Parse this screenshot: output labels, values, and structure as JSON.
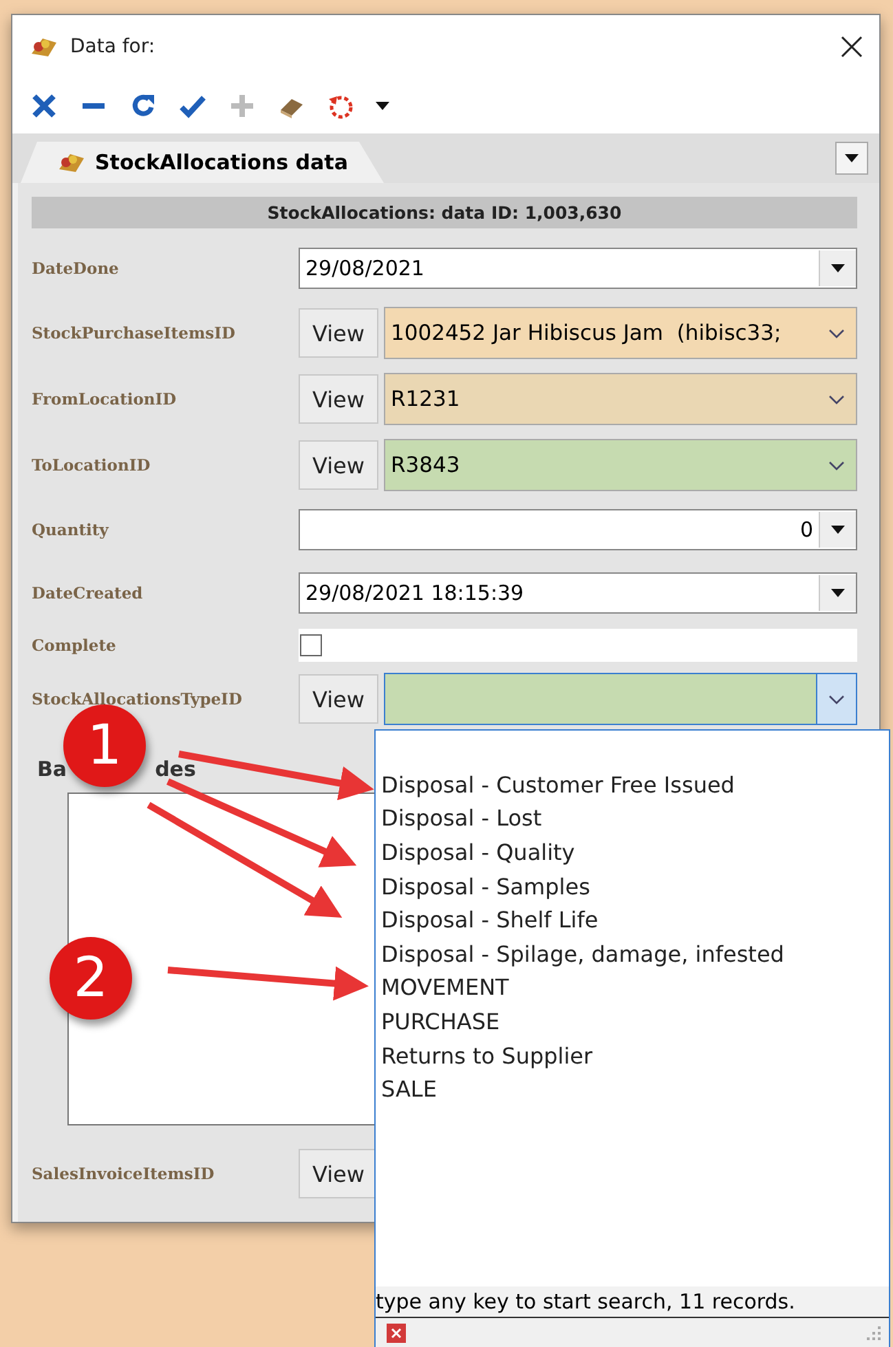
{
  "window": {
    "title": "Data for:"
  },
  "tabs": [
    {
      "label": "StockAllocations data",
      "selected": true
    }
  ],
  "header": "StockAllocations: data ID: 1,003,630",
  "fields": [
    {
      "kind": "date",
      "label": "DateDone",
      "value": "29/08/2021"
    },
    {
      "kind": "lookup",
      "label": "StockPurchaseItemsID",
      "button": "View",
      "value": "1002452 Jar Hibiscus Jam  (hibisc33;",
      "color": "#f3d9b1"
    },
    {
      "kind": "lookup",
      "label": "FromLocationID",
      "button": "View",
      "value": "R1231",
      "color": "#ead7b3"
    },
    {
      "kind": "lookup",
      "label": "ToLocationID",
      "button": "View",
      "value": "R3843",
      "color": "#c6dbb0"
    },
    {
      "kind": "number",
      "label": "Quantity",
      "value": "0"
    },
    {
      "kind": "date",
      "label": "DateCreated",
      "value": "29/08/2021 18:15:39"
    },
    {
      "kind": "checkbox",
      "label": "Complete",
      "checked": false
    },
    {
      "kind": "lookup",
      "label": "StockAllocationsTypeID",
      "button": "View",
      "color": "#c6dbb0",
      "focused": true
    }
  ],
  "barcodes": {
    "label_start": "Ba",
    "label_end": "des"
  },
  "sales_invoice": {
    "label": "SalesInvoiceItemsID",
    "button": "View"
  },
  "dropdown": {
    "items": [
      "Disposal - Customer Free Issued",
      "Disposal - Lost",
      "Disposal - Quality",
      "Disposal - Samples",
      "Disposal - Shelf Life",
      "Disposal - Spilage, damage, infested",
      "MOVEMENT",
      "PURCHASE",
      "Returns to Supplier",
      "SALE"
    ],
    "status": "type any key to start search, 11 records."
  },
  "callouts": [
    {
      "number": "1"
    },
    {
      "number": "2"
    }
  ]
}
